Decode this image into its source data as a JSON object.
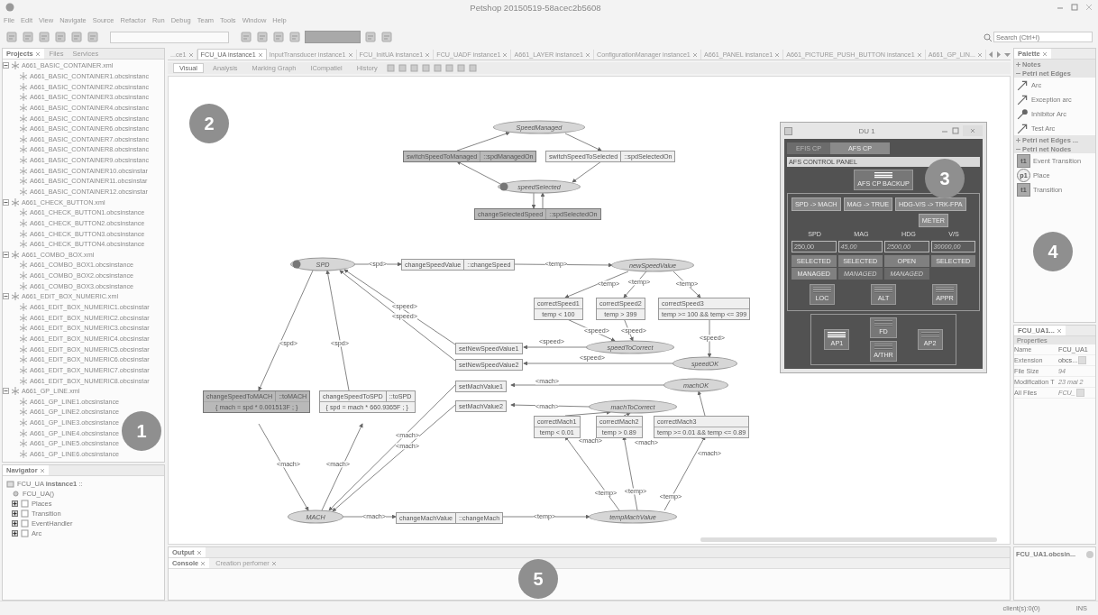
{
  "window": {
    "title": "Petshop 20150519-58acec2b5608"
  },
  "menu": [
    "File",
    "Edit",
    "View",
    "Navigate",
    "Source",
    "Refactor",
    "Run",
    "Debug",
    "Team",
    "Tools",
    "Window",
    "Help"
  ],
  "search": {
    "placeholder": "Search (Ctrl+I)"
  },
  "projects": {
    "tabs": [
      {
        "label": "Projects",
        "selected": true
      },
      {
        "label": "Files",
        "selected": false
      },
      {
        "label": "Services",
        "selected": false
      }
    ],
    "tree": [
      {
        "label": "A661_BASIC_CONTAINER.xml",
        "expanded": true,
        "children": [
          {
            "label": "A661_BASIC_CONTAINER1.obcsinstanc"
          },
          {
            "label": "A661_BASIC_CONTAINER2.obcsinstanc"
          },
          {
            "label": "A661_BASIC_CONTAINER3.obcsinstanc"
          },
          {
            "label": "A661_BASIC_CONTAINER4.obcsinstanc"
          },
          {
            "label": "A661_BASIC_CONTAINER5.obcsinstanc"
          },
          {
            "label": "A661_BASIC_CONTAINER6.obcsinstanc"
          },
          {
            "label": "A661_BASIC_CONTAINER7.obcsinstanc"
          },
          {
            "label": "A661_BASIC_CONTAINER8.obcsinstanc"
          },
          {
            "label": "A661_BASIC_CONTAINER9.obcsinstanc"
          },
          {
            "label": "A661_BASIC_CONTAINER10.obcsinstar"
          },
          {
            "label": "A661_BASIC_CONTAINER11.obcsinstar"
          },
          {
            "label": "A661_BASIC_CONTAINER12.obcsinstar"
          }
        ]
      },
      {
        "label": "A661_CHECK_BUTTON.xml",
        "expanded": true,
        "children": [
          {
            "label": "A661_CHECK_BUTTON1.obcsinstance"
          },
          {
            "label": "A661_CHECK_BUTTON2.obcsinstance"
          },
          {
            "label": "A661_CHECK_BUTTON3.obcsinstance"
          },
          {
            "label": "A661_CHECK_BUTTON4.obcsinstance"
          }
        ]
      },
      {
        "label": "A661_COMBO_BOX.xml",
        "expanded": true,
        "children": [
          {
            "label": "A661_COMBO_BOX1.obcsinstance"
          },
          {
            "label": "A661_COMBO_BOX2.obcsinstance"
          },
          {
            "label": "A661_COMBO_BOX3.obcsinstance"
          }
        ]
      },
      {
        "label": "A661_EDIT_BOX_NUMERIC.xml",
        "expanded": true,
        "children": [
          {
            "label": "A661_EDIT_BOX_NUMERIC1.obcsinstar"
          },
          {
            "label": "A661_EDIT_BOX_NUMERIC2.obcsinstar"
          },
          {
            "label": "A661_EDIT_BOX_NUMERIC3.obcsinstar"
          },
          {
            "label": "A661_EDIT_BOX_NUMERIC4.obcsinstar"
          },
          {
            "label": "A661_EDIT_BOX_NUMERIC5.obcsinstar"
          },
          {
            "label": "A661_EDIT_BOX_NUMERIC6.obcsinstar"
          },
          {
            "label": "A661_EDIT_BOX_NUMERIC7.obcsinstar"
          },
          {
            "label": "A661_EDIT_BOX_NUMERIC8.obcsinstar"
          }
        ]
      },
      {
        "label": "A661_GP_LINE.xml",
        "expanded": true,
        "children": [
          {
            "label": "A661_GP_LINE1.obcsinstance"
          },
          {
            "label": "A661_GP_LINE2.obcsinstance"
          },
          {
            "label": "A661_GP_LINE3.obcsinstance"
          },
          {
            "label": "A661_GP_LINE4.obcsinstance"
          },
          {
            "label": "A661_GP_LINE5.obcsinstance"
          },
          {
            "label": "A661_GP_LINE6.obcsinstance"
          }
        ]
      }
    ]
  },
  "navigator": {
    "title": "Navigator",
    "root": "FCU_UA **instance1** ::",
    "items": [
      {
        "kind": "method",
        "label": "FCU_UA()"
      },
      {
        "kind": "folder",
        "label": "Places"
      },
      {
        "kind": "folder",
        "label": "Transition"
      },
      {
        "kind": "folder",
        "label": "EventHandler"
      },
      {
        "kind": "folder",
        "label": "Arc"
      }
    ]
  },
  "editor": {
    "tabs": [
      {
        "label": "...ce1",
        "selected": false
      },
      {
        "label": "FCU_UA instance1",
        "selected": true
      },
      {
        "label": "InputTransducer instance1",
        "selected": false
      },
      {
        "label": "FCU_InitUA instance1",
        "selected": false
      },
      {
        "label": "FCU_UADF instance1",
        "selected": false
      },
      {
        "label": "A661_LAYER instance1",
        "selected": false
      },
      {
        "label": "ConfigurationManager instance1",
        "selected": false
      },
      {
        "label": "A661_PANEL instance1",
        "selected": false
      },
      {
        "label": "A661_PICTURE_PUSH_BUTTON instance1",
        "selected": false
      },
      {
        "label": "A661_GP_LIN...",
        "selected": false
      }
    ],
    "views": [
      {
        "label": "Visual",
        "selected": true
      },
      {
        "label": "Analysis",
        "selected": false
      },
      {
        "label": "Marking Graph",
        "selected": false
      },
      {
        "label": "ICompatiel",
        "selected": false
      },
      {
        "label": "History",
        "selected": false
      }
    ],
    "diagram": {
      "places": [
        {
          "name": "SpeedManaged",
          "marked": false
        },
        {
          "name": "speedSelected",
          "marked": true
        },
        {
          "name": "SPD",
          "marked": true
        },
        {
          "name": "newSpeedValue",
          "marked": false
        },
        {
          "name": "speedToCorrect",
          "marked": false
        },
        {
          "name": "speedOK",
          "marked": false
        },
        {
          "name": "machOK",
          "marked": false
        },
        {
          "name": "machToCorrect",
          "marked": false
        },
        {
          "name": "MACH",
          "marked": false
        },
        {
          "name": "tempMachValue",
          "marked": false
        }
      ],
      "transitions": [
        {
          "name": "switchSpeedToManaged",
          "action": "::spdManagedOn",
          "enabled": true
        },
        {
          "name": "switchSpeedToSelected",
          "action": "::spdSelectedOn",
          "enabled": false
        },
        {
          "name": "changeSelectedSpeed",
          "action": "::spdSelectedOn",
          "enabled": true
        },
        {
          "name": "changeSpeedValue",
          "action": "::changeSpeed",
          "enabled": false
        },
        {
          "name": "correctSpeed1",
          "guard": "temp < 100",
          "enabled": false
        },
        {
          "name": "correctSpeed2",
          "guard": "temp > 399",
          "enabled": false
        },
        {
          "name": "correctSpeed3",
          "guard": "temp >= 100 && temp <= 399",
          "enabled": false
        },
        {
          "name": "setNewSpeedValue1",
          "enabled": false
        },
        {
          "name": "setNewSpeedValue2",
          "enabled": false
        },
        {
          "name": "changeSpeedToMACH",
          "action": "::toMACH",
          "guard": "{ mach = spd * 0.001513F ; }",
          "enabled": true
        },
        {
          "name": "changeSpeedToSPD",
          "action": "::toSPD",
          "guard": "{ spd = mach * 660.9365F ; }",
          "enabled": false
        },
        {
          "name": "setMachValue1",
          "enabled": false
        },
        {
          "name": "setMachValue2",
          "enabled": false
        },
        {
          "name": "correctMach1",
          "guard": "temp < 0.01",
          "enabled": false
        },
        {
          "name": "correctMach2",
          "guard": "temp > 0.89",
          "enabled": false
        },
        {
          "name": "correctMach3",
          "guard": "temp >= 0.01 && temp <= 0.89",
          "enabled": false
        },
        {
          "name": "changeMachValue",
          "action": "::changeMach",
          "enabled": false
        }
      ],
      "arc_labels": [
        "<spd>",
        "<temp>",
        "<temp>",
        "<temp>",
        "<temp>",
        "<speed>",
        "<speed>",
        "<speed>",
        "<speed>",
        "<speed>",
        "<speed>",
        "<speed>",
        "<spd>",
        "<spd>",
        "<mach>",
        "<mach>",
        "<mach>",
        "<mach>",
        "<mach>",
        "<mach>",
        "<mach>",
        "<mach>",
        "<mach>",
        "<temp>",
        "<temp>",
        "<temp>",
        "<mach>",
        "<temp>"
      ]
    },
    "du_window": {
      "title": "DU 1",
      "tabs": [
        {
          "label": "EFIS CP",
          "selected": false
        },
        {
          "label": "AFS CP",
          "selected": true
        }
      ],
      "panel_title": "AFS CONTROL PANEL",
      "backup": "AFS CP BACKUP",
      "mode_buttons": [
        "SPD -> MACH",
        "MAG -> TRUE",
        "HDG-V/S -> TRK-FPA"
      ],
      "meter": "METER",
      "labels": [
        "SPD",
        "MAG",
        "HDG",
        "V/S"
      ],
      "columns": [
        {
          "value": "250,00",
          "active": true,
          "modes": [
            {
              "label": "SELECTED",
              "active": true
            },
            {
              "label": "MANAGED",
              "active": true
            }
          ]
        },
        {
          "value": "45,00",
          "active": false,
          "modes": [
            {
              "label": "SELECTED",
              "active": true
            },
            {
              "label": "MANAGED",
              "active": false
            }
          ]
        },
        {
          "value": "2500,00",
          "active": false,
          "modes": [
            {
              "label": "OPEN",
              "active": true
            },
            {
              "label": "MANAGED",
              "active": false
            }
          ]
        },
        {
          "value": "30000,00",
          "active": false,
          "modes": [
            {
              "label": "SELECTED",
              "active": true
            }
          ]
        }
      ],
      "push_buttons": [
        {
          "label": "LOC",
          "on": false
        },
        {
          "label": "ALT",
          "on": false
        },
        {
          "label": "APPR",
          "on": false
        }
      ],
      "ap_buttons": [
        {
          "label": "AP1",
          "on": true
        },
        {
          "label": "FD",
          "on": false
        },
        {
          "label": "A/THR",
          "on": false
        },
        {
          "label": "AP2",
          "on": false
        }
      ]
    }
  },
  "output": {
    "title": "Output",
    "tabs": [
      {
        "label": "Console",
        "selected": true
      },
      {
        "label": "Creation perfomer",
        "selected": false
      }
    ]
  },
  "palette": {
    "title": "Palette",
    "items": [
      {
        "kind": "group",
        "label": "Notes",
        "expanded": false
      },
      {
        "kind": "group",
        "label": "Petri net Edges",
        "expanded": true
      },
      {
        "kind": "arc",
        "label": "Arc"
      },
      {
        "kind": "exception-arc",
        "label": "Exception arc"
      },
      {
        "kind": "inhibitor-arc",
        "label": "Inhibitor Arc"
      },
      {
        "kind": "test-arc",
        "label": "Test Arc"
      },
      {
        "kind": "group",
        "label": "Petri net Edges ...",
        "expanded": false
      },
      {
        "kind": "group",
        "label": "Petri net Nodes",
        "expanded": true
      },
      {
        "kind": "event-transition",
        "label": "Event Transition",
        "icon_text": "t1"
      },
      {
        "kind": "place",
        "label": "Place",
        "icon_text": "p1"
      },
      {
        "kind": "transition",
        "label": "Transition",
        "icon_text": "t1"
      }
    ]
  },
  "properties": {
    "title": "FCU_UA1...",
    "section": "Properties",
    "rows": [
      {
        "name": "Name",
        "value": "FCU_UA1",
        "readonly": false,
        "editor": false
      },
      {
        "name": "Extension",
        "value": "obcs...",
        "readonly": false,
        "editor": true
      },
      {
        "name": "File Size",
        "value": "94",
        "readonly": true,
        "editor": false
      },
      {
        "name": "Modification T",
        "value": "23 mai 2",
        "readonly": true,
        "editor": false
      },
      {
        "name": "All Files",
        "value": "FCU_",
        "readonly": true,
        "editor": true
      }
    ]
  },
  "file_panel": {
    "title": "FCU_UA1.obcsin..."
  },
  "status_bar": {
    "left": "client(s):0(0)",
    "right": "INS"
  },
  "callouts": [
    "1",
    "2",
    "3",
    "4",
    "5"
  ]
}
